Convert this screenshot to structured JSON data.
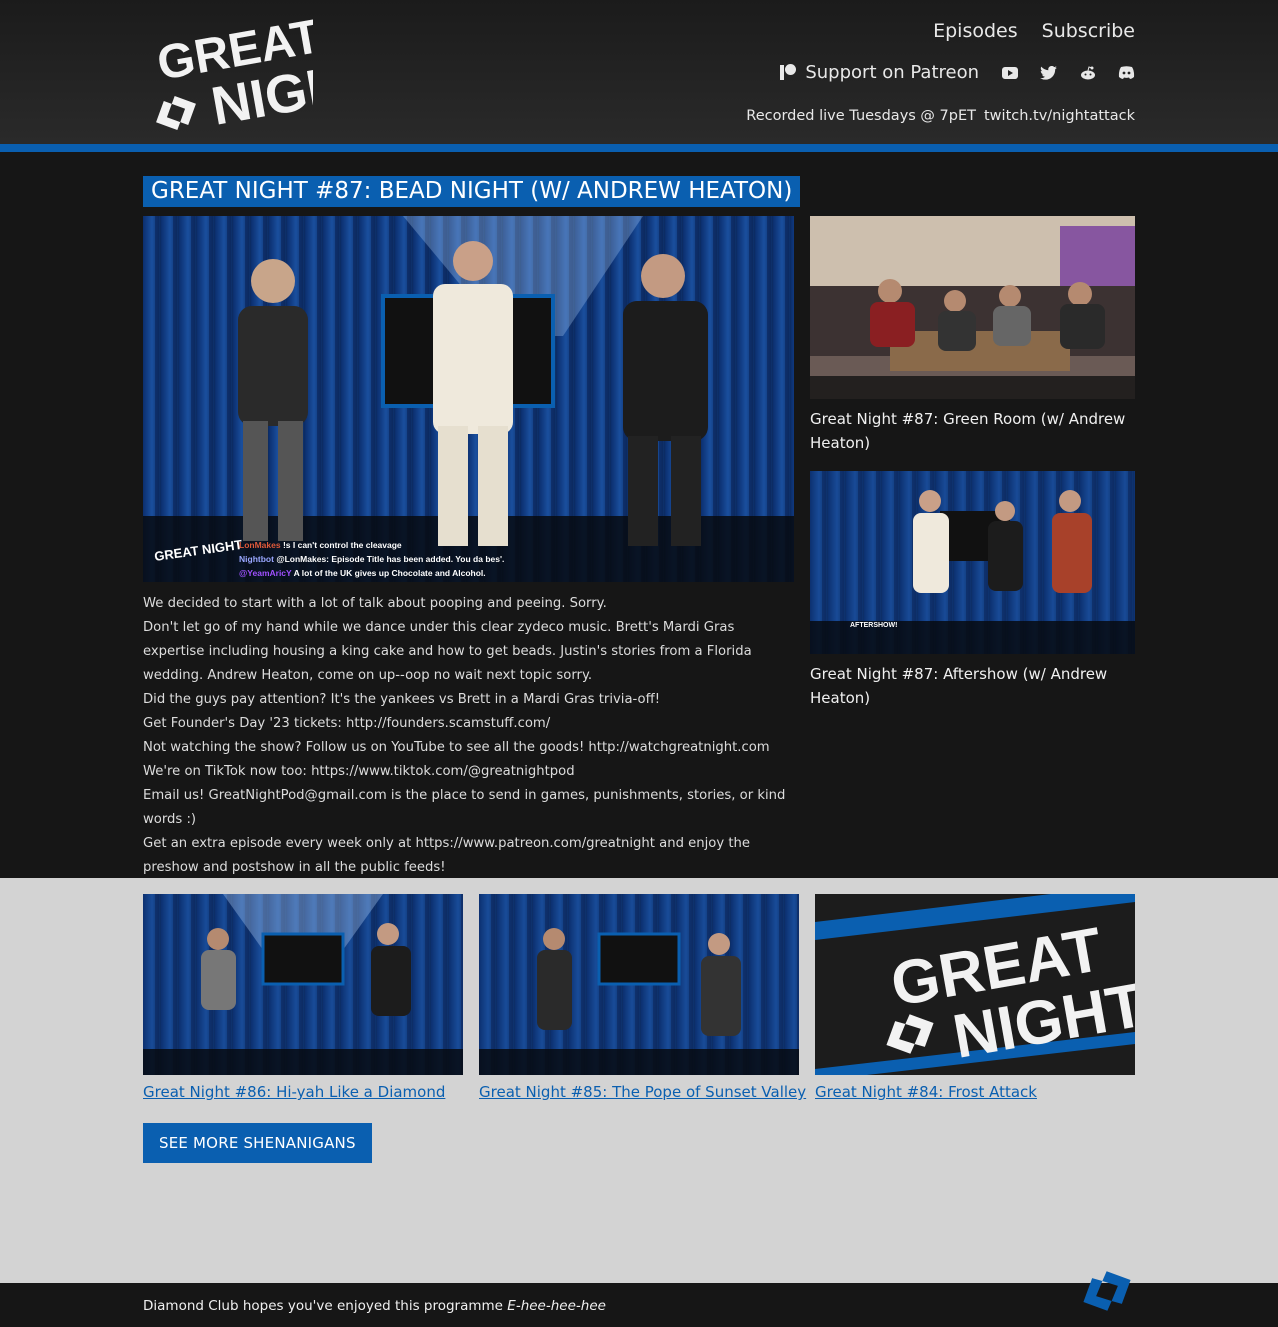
{
  "header": {
    "logo": {
      "line1": "GREAT",
      "line2": "NIGHT"
    },
    "nav": [
      {
        "label": "Episodes"
      },
      {
        "label": "Subscribe"
      }
    ],
    "patreon_label": "Support on Patreon",
    "social_icons": [
      "youtube-icon",
      "twitter-icon",
      "reddit-icon",
      "discord-icon"
    ],
    "recorded": "Recorded live Tuesdays @ 7pET",
    "twitch": "twitch.tv/nightattack"
  },
  "episode": {
    "title": "GREAT NIGHT #87: BEAD NIGHT (W/ ANDREW HEATON)",
    "chat": [
      {
        "user": "LonMakes",
        "text": "!s I can't control the cleavage"
      },
      {
        "user": "Nightbot",
        "text": "@LonMakes: Episode Title has been added. You da bes'."
      },
      {
        "user": "@YeamAricY",
        "text": "A lot of the UK gives up Chocolate and Alcohol."
      }
    ],
    "description": [
      "We decided to start with a lot of talk about pooping and peeing. Sorry.",
      "Don't let go of my hand while we dance under this clear zydeco music. Brett's Mardi Gras expertise including housing a king cake and how to get beads. Justin's stories from a Florida wedding. Andrew Heaton, come on up--oop no wait next topic sorry.",
      "Did the guys pay attention? It's the yankees vs Brett in a Mardi Gras trivia-off!",
      "Get Founder's Day '23 tickets: http://founders.scamstuff.com/",
      "Not watching the show? Follow us on YouTube to see all the goods! http://watchgreatnight.com",
      "We're on TikTok now too: https://www.tiktok.com/@greatnightpod",
      "Email us! GreatNightPod@gmail.com is the place to send in games, punishments, stories, or kind words :)",
      "Get an extra episode every week only at https://www.patreon.com/greatnight and enjoy the preshow and postshow in all the public feeds!"
    ]
  },
  "related": [
    {
      "caption": "Great Night #87: Green Room (w/ Andrew Heaton)"
    },
    {
      "caption": "Great Night #87: Aftershow (w/ Andrew Heaton)",
      "overlay": "AFTERSHOW!"
    }
  ],
  "more": [
    {
      "title": "Great Night #86: Hi-yah Like a Diamond"
    },
    {
      "title": "Great Night #85: The Pope of Sunset Valley"
    },
    {
      "title": "Great Night #84: Frost Attack"
    }
  ],
  "more_button": "SEE MORE SHENANIGANS",
  "footer": {
    "message": "Diamond Club hopes you've enjoyed this programme",
    "tagline": "E-hee-hee-hee"
  },
  "colors": {
    "accent_blue": "#0a5fb0",
    "header_bg": "#222222",
    "page_bg": "#161616",
    "lower_bg": "#d3d3d3"
  }
}
